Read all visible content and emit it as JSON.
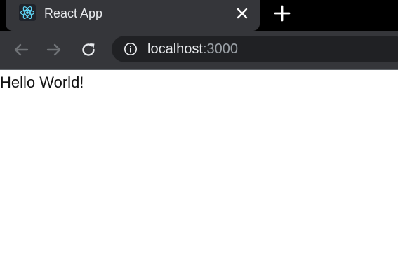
{
  "browser": {
    "tab": {
      "favicon_icon": "react-logo-icon",
      "title": "React App",
      "close_icon": "close-icon"
    },
    "new_tab_icon": "plus-icon",
    "toolbar": {
      "back_icon": "arrow-left-icon",
      "forward_icon": "arrow-right-icon",
      "reload_icon": "reload-icon",
      "site_info_icon": "info-icon",
      "url_host": "localhost",
      "url_port": ":3000"
    },
    "colors": {
      "tabstrip_bg": "#000000",
      "toolbar_bg": "#35363a",
      "omnibox_bg": "#202124",
      "react_accent": "#61dafb"
    }
  },
  "page": {
    "text": "Hello World!"
  }
}
